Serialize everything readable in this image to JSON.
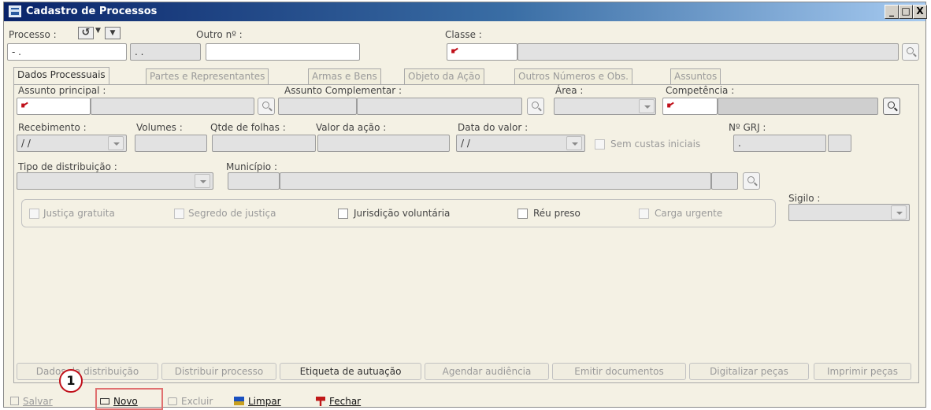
{
  "window": {
    "title": "Cadastro de Processos",
    "controls": [
      "_",
      "□",
      "X"
    ]
  },
  "top": {
    "processo_label": "Processo :",
    "processo_value": " - .",
    "processo_value2": ". .",
    "outro_label": "Outro nº :",
    "classe_label": "Classe :"
  },
  "tabs": [
    {
      "label": "Dados Processuais",
      "active": true
    },
    {
      "label": "Partes e Representantes",
      "active": false
    },
    {
      "label": "Armas e Bens",
      "active": false
    },
    {
      "label": "Objeto da Ação",
      "active": false
    },
    {
      "label": "Outros Números e Obs.",
      "active": false
    },
    {
      "label": "Assuntos",
      "active": false
    }
  ],
  "form": {
    "assunto_principal_label": "Assunto principal :",
    "assunto_complementar_label": "Assunto Complementar :",
    "area_label": "Área :",
    "competencia_label": "Competência :",
    "recebimento_label": "Recebimento :",
    "recebimento_value": "/ /",
    "volumes_label": "Volumes :",
    "qtde_folhas_label": "Qtde de folhas :",
    "valor_acao_label": "Valor da ação :",
    "data_valor_label": "Data do valor :",
    "data_valor_value": "/ /",
    "sem_custas_label": "Sem custas iniciais",
    "grj_label": "Nº GRJ :",
    "grj_value": ".",
    "tipo_distribuicao_label": "Tipo de distribuição :",
    "municipio_label": "Município :",
    "sigilo_label": "Sigilo :"
  },
  "checkboxes": {
    "justica_gratuita": "Justiça gratuita",
    "segredo_justica": "Segredo de justiça",
    "jurisdicao_voluntaria": "Jurisdição voluntária",
    "reu_preso": "Réu preso",
    "carga_urgente": "Carga urgente"
  },
  "action_buttons": {
    "dados_distribuicao": "Dados da distribuição",
    "distribuir_processo": "Distribuir processo",
    "etiqueta_autuacao": "Etiqueta de autuação",
    "agendar_audiencia": "Agendar audiência",
    "emitir_documentos": "Emitir documentos",
    "digitalizar_pecas": "Digitalizar peças",
    "imprimir_pecas": "Imprimir peças"
  },
  "toolbar": {
    "salvar": "Salvar",
    "novo": "Novo",
    "excluir": "Excluir",
    "limpar": "Limpar",
    "fechar": "Fechar"
  },
  "callout_number": "1",
  "colors": {
    "title_start": "#0a246a",
    "title_end": "#a6caf0",
    "required_mark": "#c0101a",
    "panel_bg": "#f4f1e4",
    "callout": "#c0101a"
  }
}
